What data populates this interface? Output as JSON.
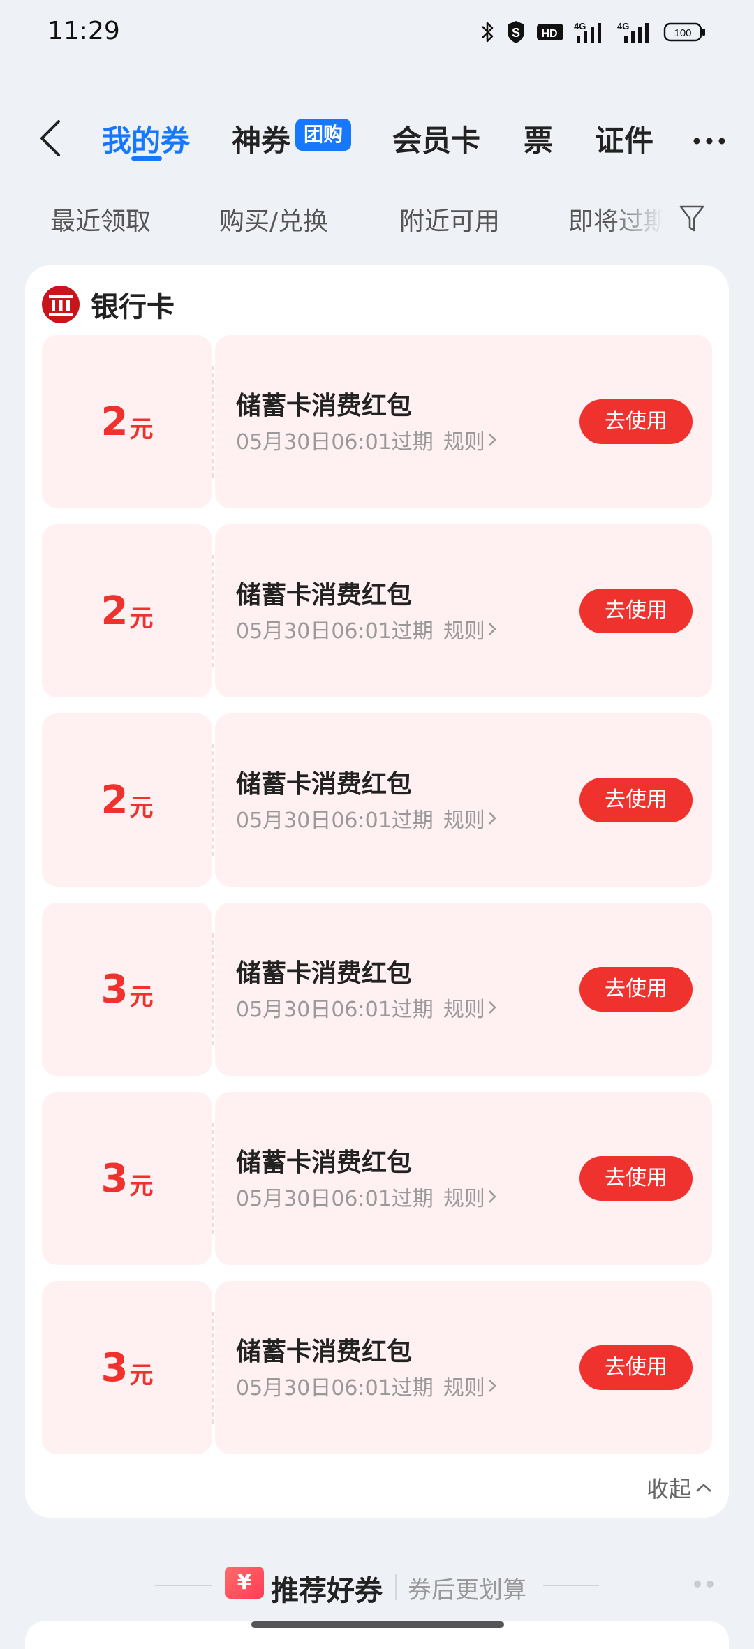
{
  "status_bar": {
    "time": "11:29",
    "network_1": "4G",
    "network_2": "4G",
    "battery": "100",
    "icons": [
      "bluetooth-icon",
      "shield-icon",
      "hd-icon",
      "signal-icon",
      "signal-icon",
      "battery-icon"
    ]
  },
  "header": {
    "tabs": [
      {
        "label": "我的券"
      },
      {
        "label": "神券"
      },
      {
        "label": "会员卡"
      },
      {
        "label": "票"
      },
      {
        "label": "证件"
      }
    ],
    "badge": "团购"
  },
  "filters": [
    {
      "label": "最近领取"
    },
    {
      "label": "购买/兑换"
    },
    {
      "label": "附近可用"
    },
    {
      "label": "即将过期"
    }
  ],
  "section": {
    "title": "银行卡",
    "collapse_label": "收起"
  },
  "coupons": [
    {
      "amount": "2",
      "unit": "元",
      "name": "储蓄卡消费红包",
      "expiry": "05月30日06:01过期",
      "rule": "规则",
      "button": "去使用"
    },
    {
      "amount": "2",
      "unit": "元",
      "name": "储蓄卡消费红包",
      "expiry": "05月30日06:01过期",
      "rule": "规则",
      "button": "去使用"
    },
    {
      "amount": "2",
      "unit": "元",
      "name": "储蓄卡消费红包",
      "expiry": "05月30日06:01过期",
      "rule": "规则",
      "button": "去使用"
    },
    {
      "amount": "3",
      "unit": "元",
      "name": "储蓄卡消费红包",
      "expiry": "05月30日06:01过期",
      "rule": "规则",
      "button": "去使用"
    },
    {
      "amount": "3",
      "unit": "元",
      "name": "储蓄卡消费红包",
      "expiry": "05月30日06:01过期",
      "rule": "规则",
      "button": "去使用"
    },
    {
      "amount": "3",
      "unit": "元",
      "name": "储蓄卡消费红包",
      "expiry": "05月30日06:01过期",
      "rule": "规则",
      "button": "去使用"
    }
  ],
  "recommend": {
    "icon_text": "¥",
    "title": "推荐好券",
    "subtitle": "券后更划算"
  },
  "colors": {
    "accent_blue": "#1677ff",
    "coupon_red": "#f0322e",
    "coupon_bg": "#fff0f2",
    "page_bg": "#eef1f6"
  }
}
